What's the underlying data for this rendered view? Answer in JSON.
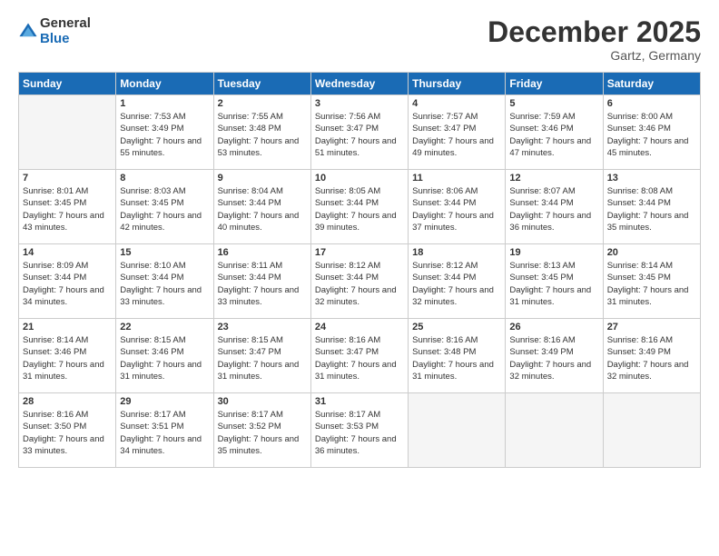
{
  "header": {
    "logo_general": "General",
    "logo_blue": "Blue",
    "month_title": "December 2025",
    "location": "Gartz, Germany"
  },
  "weekdays": [
    "Sunday",
    "Monday",
    "Tuesday",
    "Wednesday",
    "Thursday",
    "Friday",
    "Saturday"
  ],
  "weeks": [
    [
      {
        "day": "",
        "empty": true
      },
      {
        "day": "1",
        "sunrise": "7:53 AM",
        "sunset": "3:49 PM",
        "daylight": "7 hours and 55 minutes."
      },
      {
        "day": "2",
        "sunrise": "7:55 AM",
        "sunset": "3:48 PM",
        "daylight": "7 hours and 53 minutes."
      },
      {
        "day": "3",
        "sunrise": "7:56 AM",
        "sunset": "3:47 PM",
        "daylight": "7 hours and 51 minutes."
      },
      {
        "day": "4",
        "sunrise": "7:57 AM",
        "sunset": "3:47 PM",
        "daylight": "7 hours and 49 minutes."
      },
      {
        "day": "5",
        "sunrise": "7:59 AM",
        "sunset": "3:46 PM",
        "daylight": "7 hours and 47 minutes."
      },
      {
        "day": "6",
        "sunrise": "8:00 AM",
        "sunset": "3:46 PM",
        "daylight": "7 hours and 45 minutes."
      }
    ],
    [
      {
        "day": "7",
        "sunrise": "8:01 AM",
        "sunset": "3:45 PM",
        "daylight": "7 hours and 43 minutes."
      },
      {
        "day": "8",
        "sunrise": "8:03 AM",
        "sunset": "3:45 PM",
        "daylight": "7 hours and 42 minutes."
      },
      {
        "day": "9",
        "sunrise": "8:04 AM",
        "sunset": "3:44 PM",
        "daylight": "7 hours and 40 minutes."
      },
      {
        "day": "10",
        "sunrise": "8:05 AM",
        "sunset": "3:44 PM",
        "daylight": "7 hours and 39 minutes."
      },
      {
        "day": "11",
        "sunrise": "8:06 AM",
        "sunset": "3:44 PM",
        "daylight": "7 hours and 37 minutes."
      },
      {
        "day": "12",
        "sunrise": "8:07 AM",
        "sunset": "3:44 PM",
        "daylight": "7 hours and 36 minutes."
      },
      {
        "day": "13",
        "sunrise": "8:08 AM",
        "sunset": "3:44 PM",
        "daylight": "7 hours and 35 minutes."
      }
    ],
    [
      {
        "day": "14",
        "sunrise": "8:09 AM",
        "sunset": "3:44 PM",
        "daylight": "7 hours and 34 minutes."
      },
      {
        "day": "15",
        "sunrise": "8:10 AM",
        "sunset": "3:44 PM",
        "daylight": "7 hours and 33 minutes."
      },
      {
        "day": "16",
        "sunrise": "8:11 AM",
        "sunset": "3:44 PM",
        "daylight": "7 hours and 33 minutes."
      },
      {
        "day": "17",
        "sunrise": "8:12 AM",
        "sunset": "3:44 PM",
        "daylight": "7 hours and 32 minutes."
      },
      {
        "day": "18",
        "sunrise": "8:12 AM",
        "sunset": "3:44 PM",
        "daylight": "7 hours and 32 minutes."
      },
      {
        "day": "19",
        "sunrise": "8:13 AM",
        "sunset": "3:45 PM",
        "daylight": "7 hours and 31 minutes."
      },
      {
        "day": "20",
        "sunrise": "8:14 AM",
        "sunset": "3:45 PM",
        "daylight": "7 hours and 31 minutes."
      }
    ],
    [
      {
        "day": "21",
        "sunrise": "8:14 AM",
        "sunset": "3:46 PM",
        "daylight": "7 hours and 31 minutes."
      },
      {
        "day": "22",
        "sunrise": "8:15 AM",
        "sunset": "3:46 PM",
        "daylight": "7 hours and 31 minutes."
      },
      {
        "day": "23",
        "sunrise": "8:15 AM",
        "sunset": "3:47 PM",
        "daylight": "7 hours and 31 minutes."
      },
      {
        "day": "24",
        "sunrise": "8:16 AM",
        "sunset": "3:47 PM",
        "daylight": "7 hours and 31 minutes."
      },
      {
        "day": "25",
        "sunrise": "8:16 AM",
        "sunset": "3:48 PM",
        "daylight": "7 hours and 31 minutes."
      },
      {
        "day": "26",
        "sunrise": "8:16 AM",
        "sunset": "3:49 PM",
        "daylight": "7 hours and 32 minutes."
      },
      {
        "day": "27",
        "sunrise": "8:16 AM",
        "sunset": "3:49 PM",
        "daylight": "7 hours and 32 minutes."
      }
    ],
    [
      {
        "day": "28",
        "sunrise": "8:16 AM",
        "sunset": "3:50 PM",
        "daylight": "7 hours and 33 minutes."
      },
      {
        "day": "29",
        "sunrise": "8:17 AM",
        "sunset": "3:51 PM",
        "daylight": "7 hours and 34 minutes."
      },
      {
        "day": "30",
        "sunrise": "8:17 AM",
        "sunset": "3:52 PM",
        "daylight": "7 hours and 35 minutes."
      },
      {
        "day": "31",
        "sunrise": "8:17 AM",
        "sunset": "3:53 PM",
        "daylight": "7 hours and 36 minutes."
      },
      {
        "day": "",
        "empty": true
      },
      {
        "day": "",
        "empty": true
      },
      {
        "day": "",
        "empty": true
      }
    ]
  ]
}
